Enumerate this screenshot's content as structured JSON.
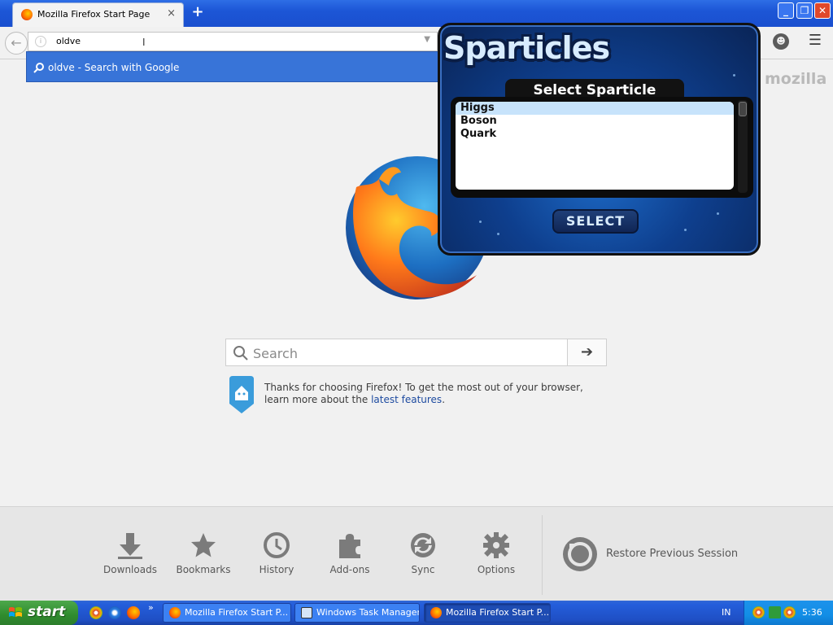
{
  "browser": {
    "tab": {
      "title": "Mozilla Firefox Start Page",
      "close": "×"
    },
    "new_tab": "+",
    "window_controls": {
      "minimize": "_",
      "maximize": "❐",
      "close": "✕"
    },
    "nav": {
      "back": "←",
      "url_value": "oldve",
      "url_dropdown": "▼",
      "menu": "☰",
      "account": "☻"
    },
    "autocomplete": {
      "item": "oldve - Search with Google"
    },
    "brand": "mozilla",
    "search": {
      "placeholder": "Search",
      "go": "➔"
    },
    "tip": {
      "text_before": "Thanks for choosing Firefox! To get the most out of your browser, learn more about the ",
      "link": "latest features",
      "text_after": "."
    },
    "launcher": {
      "items": [
        {
          "label": "Downloads",
          "icon": "download-icon"
        },
        {
          "label": "Bookmarks",
          "icon": "star-icon"
        },
        {
          "label": "History",
          "icon": "clock-icon"
        },
        {
          "label": "Add-ons",
          "icon": "puzzle-icon"
        },
        {
          "label": "Sync",
          "icon": "sync-icon"
        },
        {
          "label": "Options",
          "icon": "gear-icon"
        }
      ],
      "restore": "Restore Previous Session"
    }
  },
  "sparticles": {
    "title": "Sparticles",
    "header": "Select Sparticle",
    "options": [
      "Higgs",
      "Boson",
      "Quark"
    ],
    "selected": "Higgs",
    "select_button": "SELECT"
  },
  "taskbar": {
    "start": "start",
    "more": "»",
    "tasks": [
      {
        "label": "Mozilla Firefox Start P...",
        "icon": "firefox-icon"
      },
      {
        "label": "Windows Task Manager",
        "icon": "task-manager-icon"
      },
      {
        "label": "Mozilla Firefox Start P...",
        "icon": "firefox-icon",
        "active": true
      }
    ],
    "language": "IN",
    "clock": "5:36"
  }
}
